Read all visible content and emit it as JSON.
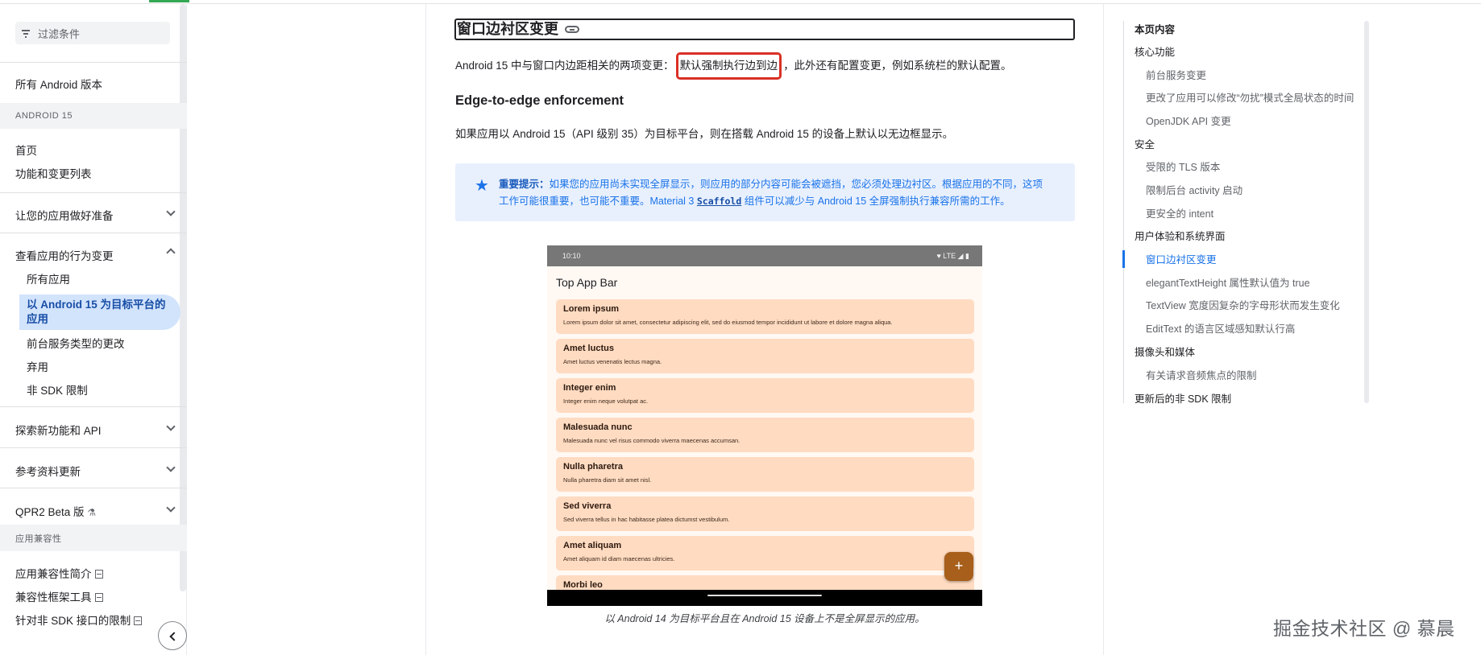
{
  "sidebar": {
    "filter_placeholder": "过滤条件",
    "all_versions": "所有 Android 版本",
    "section_android15": "ANDROID 15",
    "home": "首页",
    "features_list": "功能和变更列表",
    "prepare_app": "让您的应用做好准备",
    "behavior_changes": "查看应用的行为变更",
    "all_apps": "所有应用",
    "target_android15": "以 Android 15 为目标平台的应用",
    "foreground_service_types": "前台服务类型的更改",
    "deprecations": "弃用",
    "non_sdk": "非 SDK 限制",
    "explore_features": "探索新功能和 API",
    "reference_updates": "参考资料更新",
    "qpr2_beta": "QPR2 Beta 版",
    "section_compat": "应用兼容性",
    "compat_intro": "应用兼容性简介",
    "compat_framework": "兼容性框架工具",
    "non_sdk_restrictions": "针对非 SDK 接口的限制"
  },
  "main": {
    "heading": "窗口边衬区变更",
    "para1_prefix": "Android 15 中与窗口内边距相关的两项变更：",
    "para1_highlight": "默认强制执行边到边",
    "para1_suffix": "，此外还有配置变更，例如系统栏的默认配置。",
    "subheading": "Edge-to-edge enforcement",
    "para2": "如果应用以 Android 15（API 级别 35）为目标平台，则在搭载 Android 15 的设备上默认以无边框显示。",
    "note_label": "重要提示：",
    "note_text1": "如果您的应用尚未实现全屏显示，则应用的部分内容可能会被遮挡，您必须处理边衬区。根据应用的不同，这项",
    "note_text2a": "工作可能很重要，也可能不重要。Material 3 ",
    "note_code": "Scaffold",
    "note_text2b": " 组件可以减少与 Android 15 全屏强制执行兼容所需的工作。",
    "caption": "以 Android 14 为目标平台且在 Android 15 设备上不是全屏显示的应用。"
  },
  "phone": {
    "time": "10:10",
    "status_right": "♥ LTE ◢ ▮",
    "app_bar_title": "Top App Bar",
    "fab_label": "+",
    "cards": [
      {
        "title": "Lorem ipsum",
        "desc": "Lorem ipsum dolor sit amet, consectetur adipiscing elit, sed do eiusmod tempor incididunt ut labore et dolore magna aliqua."
      },
      {
        "title": "Amet luctus",
        "desc": "Amet luctus venenatis lectus magna."
      },
      {
        "title": "Integer enim",
        "desc": "Integer enim neque volutpat ac."
      },
      {
        "title": "Malesuada nunc",
        "desc": "Malesuada nunc vel risus commodo viverra maecenas accumsan."
      },
      {
        "title": "Nulla pharetra",
        "desc": "Nulla pharetra diam sit amet nisl."
      },
      {
        "title": "Sed viverra",
        "desc": "Sed viverra tellus in hac habitasse platea dictumst vestibulum."
      },
      {
        "title": "Amet aliquam",
        "desc": "Amet aliquam id diam maecenas ultricies."
      },
      {
        "title": "Morbi leo",
        "desc": ""
      }
    ]
  },
  "toc": {
    "title": "本页内容",
    "core": "核心功能",
    "fg_service": "前台服务变更",
    "dnd": "更改了应用可以修改“勿扰”模式全局状态的时间",
    "openjdk": "OpenJDK API 变更",
    "security": "安全",
    "tls": "受限的 TLS 版本",
    "bg_activity": "限制后台 activity 启动",
    "safer_intent": "更安全的 intent",
    "ux": "用户体验和系统界面",
    "insets": "窗口边衬区变更",
    "elegant": "elegantTextHeight 属性默认值为 true",
    "textview": "TextView 宽度因复杂的字母形状而发生变化",
    "edittext": "EditText 的语言区域感知默认行高",
    "camera": "摄像头和媒体",
    "audio": "有关请求音频焦点的限制",
    "non_sdk_updated": "更新后的非 SDK 限制"
  },
  "watermark": "掘金技术社区 @ 慕晨"
}
